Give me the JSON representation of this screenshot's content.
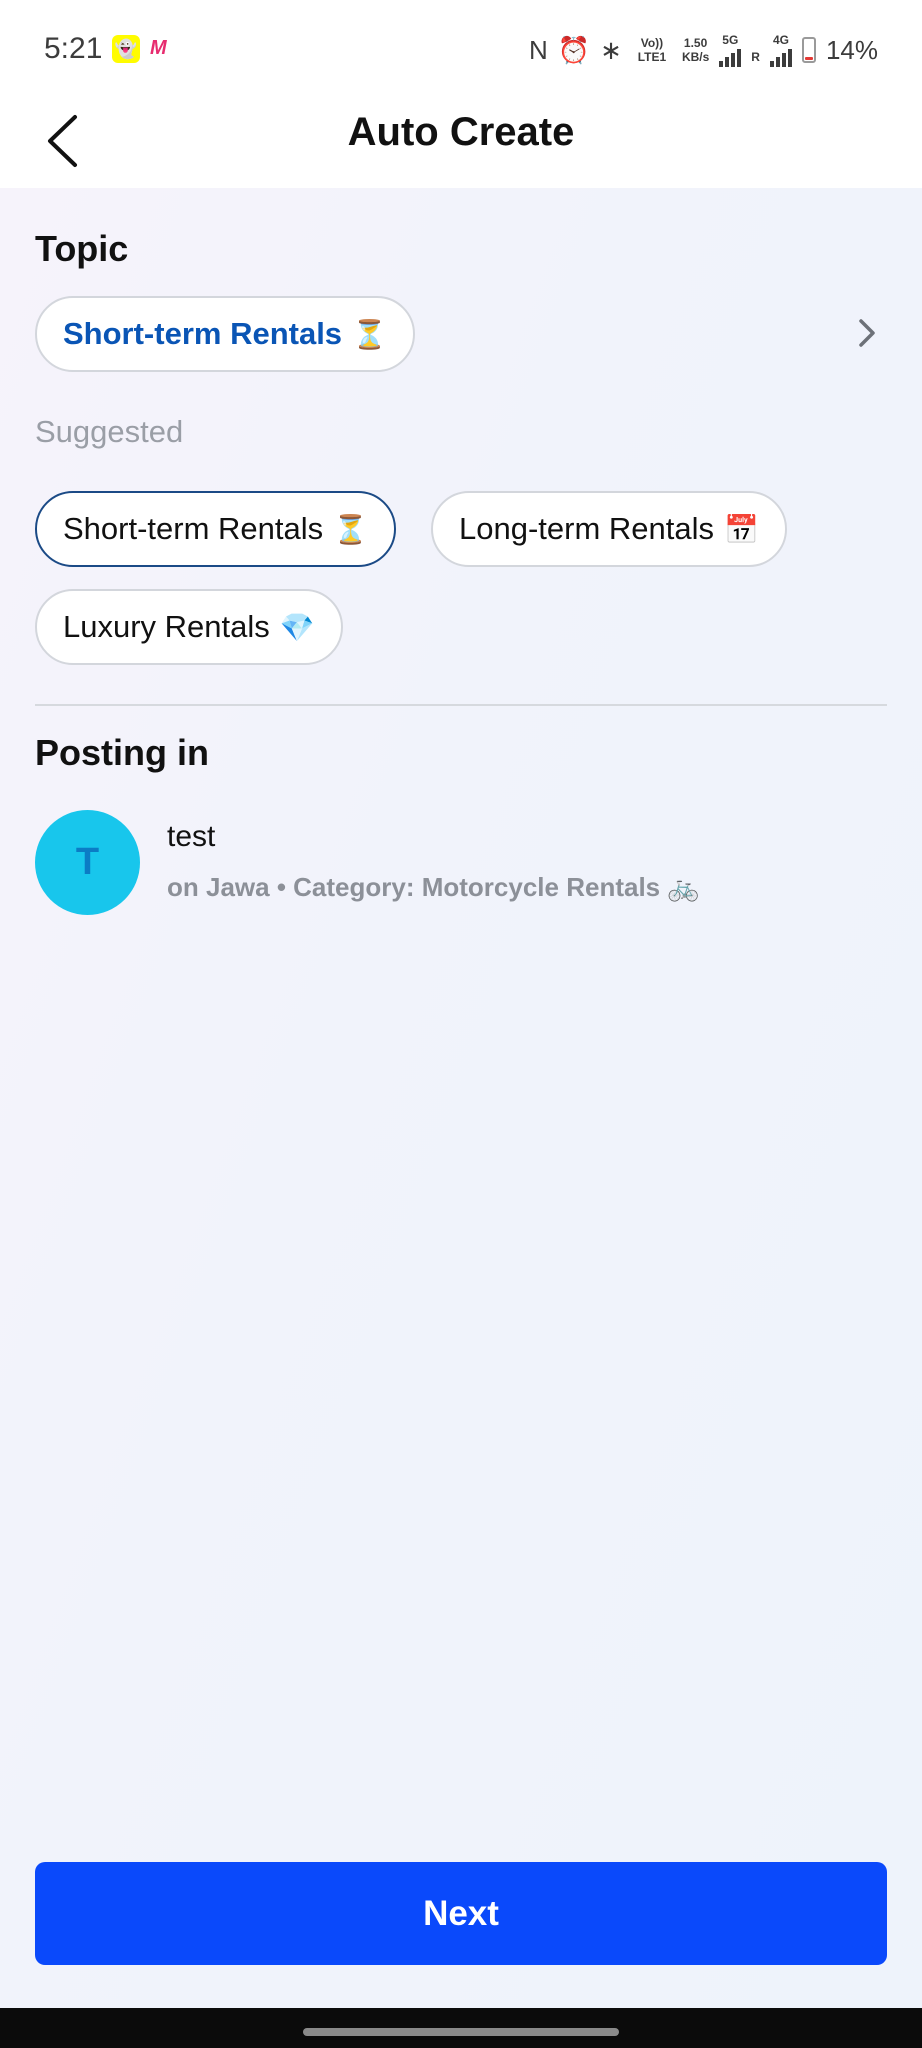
{
  "status_bar": {
    "time": "5:21",
    "net_type": "Vo)) LTE1",
    "speed_value": "1.50",
    "speed_unit": "KB/s",
    "sim1_label": "5G",
    "sim2_label": "4G",
    "roaming": "R",
    "battery_percent": "14%",
    "battery_level": 0.14
  },
  "header": {
    "title": "Auto Create",
    "back_icon": "chevron-left-icon"
  },
  "topic": {
    "heading": "Topic",
    "selected_label": "Short-term Rentals",
    "selected_emoji": "⏳",
    "arrow_icon": "chevron-right-icon"
  },
  "suggested": {
    "heading": "Suggested",
    "items": [
      {
        "label": "Short-term Rentals",
        "emoji": "⏳"
      },
      {
        "label": "Long-term Rentals",
        "emoji": "📅"
      },
      {
        "label": "Luxury Rentals",
        "emoji": "💎"
      }
    ]
  },
  "posting_in": {
    "heading": "Posting in",
    "avatar_letter": "T",
    "name": "test",
    "meta": "on Jawa • Category: Motorcycle Rentals 🚲"
  },
  "footer": {
    "next_label": "Next"
  },
  "colors": {
    "accent": "#0a49fb",
    "topic_text": "#0a55b5",
    "avatar_bg": "#18c6ec"
  }
}
